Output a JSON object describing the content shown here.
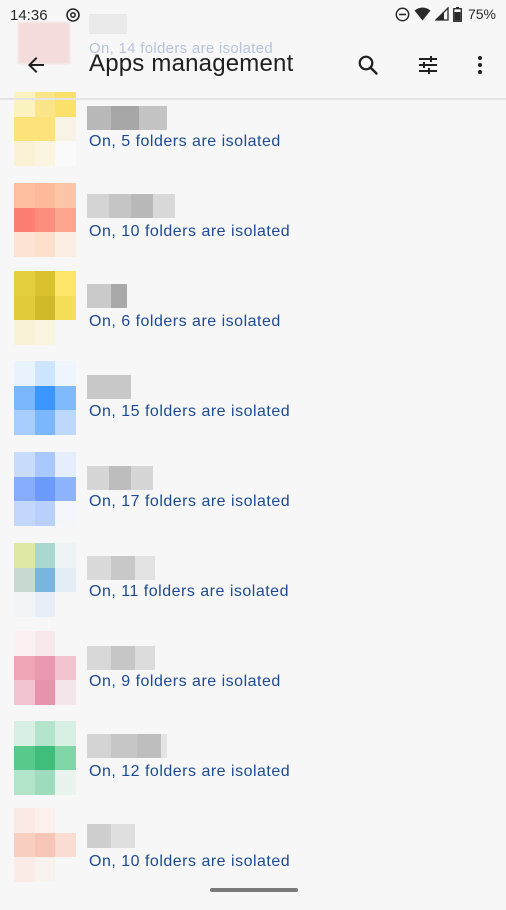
{
  "status_bar": {
    "time": "14:36",
    "battery": "75%"
  },
  "app_bar": {
    "title": "Apps management",
    "partial_row_status": "On, 14 folders are isolated"
  },
  "apps": [
    {
      "status": "On, 5 folders are isolated"
    },
    {
      "status": "On, 10 folders are isolated"
    },
    {
      "status": "On, 6 folders are isolated"
    },
    {
      "status": "On, 15 folders are isolated"
    },
    {
      "status": "On, 17 folders are isolated"
    },
    {
      "status": "On, 11 folders are isolated"
    },
    {
      "status": "On, 9 folders are isolated"
    },
    {
      "status": "On, 12 folders are isolated"
    },
    {
      "status": "On, 10 folders are isolated"
    }
  ],
  "colors": {
    "accent_text": "#1c4a96",
    "background": "#f7f7f7"
  },
  "icons": {
    "back": "arrow-back-icon",
    "search": "search-icon",
    "filter": "tune-icon",
    "more": "more-vert-icon"
  }
}
